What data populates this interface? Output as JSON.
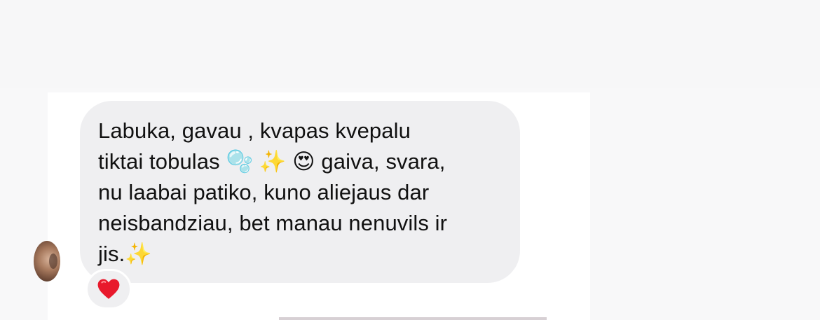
{
  "message": {
    "line1": "Labuka, gavau , kvapas kvepalu",
    "line2_start": "tiktai tobulas ",
    "emoji_bubbles": "🫧",
    "emoji_sparkles": "✨",
    "emoji_heart_eyes": "😍",
    "line2_end": " gaiva, svara,",
    "line3": "nu laabai patiko, kuno aliejaus dar",
    "line4": "neisbandziau, bet manau nenuvils ir",
    "line5_start": "jis.",
    "line5_emoji": "✨"
  },
  "reaction": {
    "emoji": "heart-icon",
    "color": "#e8192c"
  },
  "colors": {
    "bubble": "#efeff1",
    "text": "#111111",
    "panel": "#ffffff",
    "background": "#f8f8f9"
  }
}
